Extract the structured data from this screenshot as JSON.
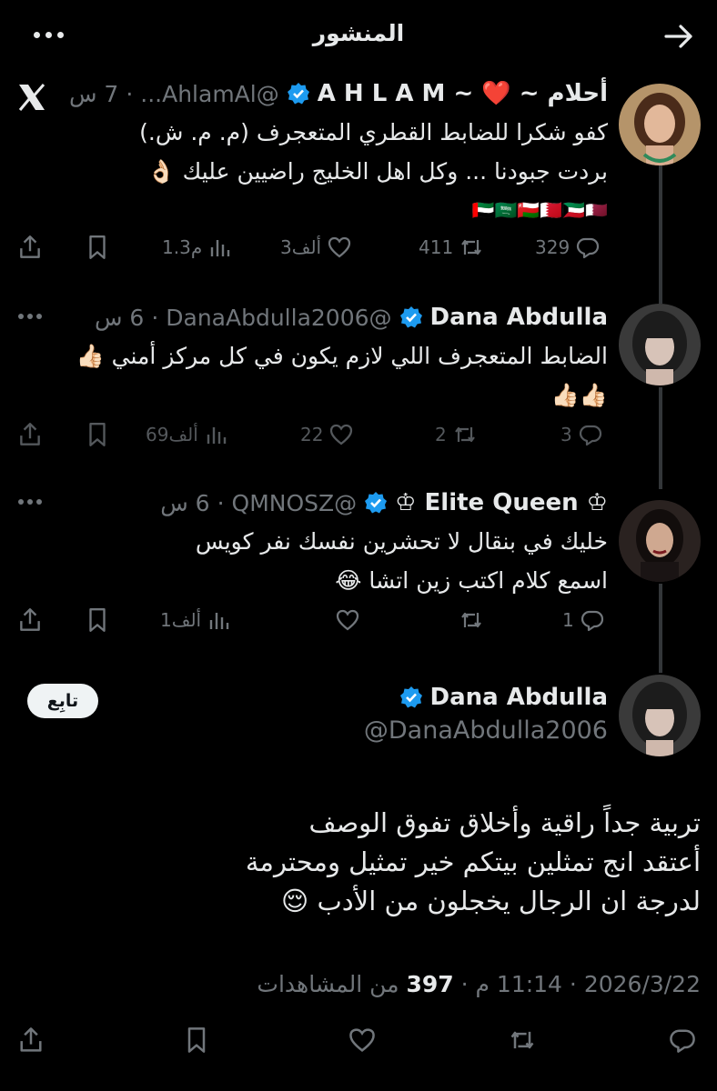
{
  "header": {
    "title": "المنشور",
    "back_icon": "arrow-right-icon",
    "more_icon": "more-dots-icon"
  },
  "colors": {
    "background": "#000000",
    "text": "#e7e9ea",
    "muted": "#71767b",
    "verified": "#1d9bf0",
    "thread_line": "#333639"
  },
  "posts": [
    {
      "name": "أحلام ~ ❤️ ~ A H L A M",
      "handle": "@AhlamAl...",
      "time": "7 س",
      "lines": [
        "كفو  شكرا للضابط القطري المتعجرف  (م. م. ش.)",
        "بردت جبودنا ... وكل اهل الخليج راضيين عليك 👌🏻",
        "🇦🇪🇸🇦🇴🇲🇧🇭🇰🇼🇶🇦"
      ],
      "stats": {
        "replies": "329",
        "reposts": "411",
        "likes": "3ألف",
        "views": "1.3م"
      }
    },
    {
      "name": "Dana Abdulla",
      "handle": "@DanaAbdulla2006",
      "time": "6 س",
      "lines": [
        "الضابط المتعجرف اللي لازم يكون في كل مركز أمني 👍🏻",
        "👍🏻👍🏻"
      ],
      "stats": {
        "replies": "3",
        "reposts": "2",
        "likes": "22",
        "views": "69ألف"
      }
    },
    {
      "name": "♔ Elite Queen ♔",
      "handle": "@QMNOSZ",
      "time": "6 س",
      "lines": [
        "خليك في بنقال لا تحشرين نفسك نفر كويس",
        "اسمع كلام اكتب زين اتشا 😂"
      ],
      "stats": {
        "replies": "1",
        "reposts": "",
        "likes": "",
        "views": "1ألف"
      }
    }
  ],
  "main_post": {
    "name": "Dana Abdulla",
    "handle": "@DanaAbdulla2006",
    "follow_label": "تابِع",
    "lines": [
      "تربية جداً راقية وأخلاق تفوق الوصف",
      "أعتقد انج تمثلين بيتكم خير تمثيل ومحترمة",
      "لدرجة ان الرجال يخجلون من الأدب 😌"
    ],
    "timestamp": "2026/3/22 · 11:14 م · ",
    "views_count": "397",
    "views_label": " من المشاهدات"
  }
}
